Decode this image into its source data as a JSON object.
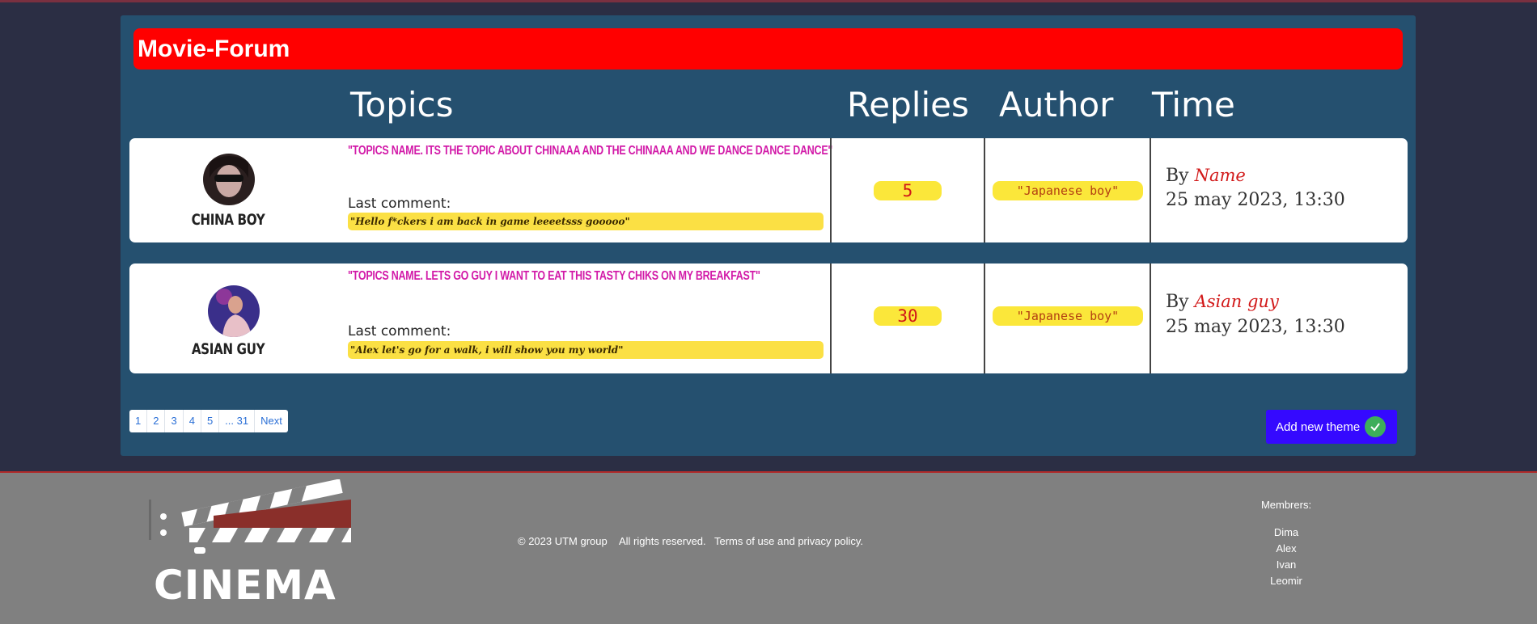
{
  "forum": {
    "title": "Movie-Forum"
  },
  "columns": {
    "topics": "Topics",
    "replies": "Replies",
    "author": "Author",
    "time": "Time"
  },
  "topics": [
    {
      "user": "CHINA BOY",
      "title": "\"TOPICS NAME. ITS THE TOPIC ABOUT CHINAAA AND THE CHINAAA AND WE DANCE DANCE DANCE\"",
      "last_comment_label": "Last comment:",
      "last_comment": "\"Hello f*ckers i am back in game leeeetsss gooooo\"",
      "replies": "5",
      "author": "\"Japanese boy\"",
      "by_prefix": "By",
      "by_name": "Name",
      "time": "25 may 2023, 13:30"
    },
    {
      "user": "ASIAN GUY",
      "title": "\"TOPICS NAME. LETS GO GUY I WANT TO EAT THIS TASTY CHIKS ON MY BREAKFAST\"",
      "last_comment_label": "Last comment:",
      "last_comment": "\"Alex let's go for a walk, i will show you my world\"",
      "replies": "30",
      "author": "\"Japanese boy\"",
      "by_prefix": "By",
      "by_name": "Asian guy",
      "time": "25 may 2023, 13:30"
    }
  ],
  "pagination": {
    "pages": [
      "1",
      "2",
      "3",
      "4",
      "5",
      "... 31"
    ],
    "next": "Next"
  },
  "add_button": {
    "label": "Add new theme"
  },
  "footer": {
    "logo_text": "CINEMA",
    "copyright": "© 2023 UTM group",
    "rights": "All rights reserved.",
    "terms": "Terms of use and privacy policy.",
    "members_label": "Membrers:",
    "members": [
      "Dima",
      "Alex",
      "Ivan",
      "Leomir"
    ]
  },
  "colors": {
    "accent": "#ff0000",
    "panel": "#25506f",
    "button": "#3509ff",
    "highlight": "#fbe73a"
  }
}
